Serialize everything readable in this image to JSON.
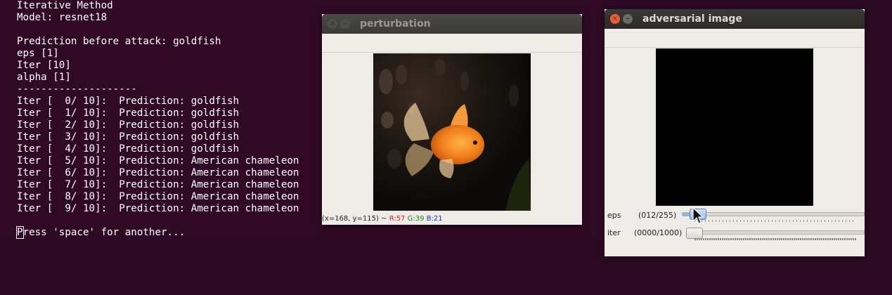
{
  "terminal": {
    "lines": [
      "Iterative Method",
      "Model: resnet18",
      "",
      "Prediction before attack: goldfish",
      "eps [1]",
      "Iter [10]",
      "alpha [1]",
      "--------------------",
      "Iter [  0/ 10]:  Prediction: goldfish",
      "Iter [  1/ 10]:  Prediction: goldfish",
      "Iter [  2/ 10]:  Prediction: goldfish",
      "Iter [  3/ 10]:  Prediction: goldfish",
      "Iter [  4/ 10]:  Prediction: goldfish",
      "Iter [  5/ 10]:  Prediction: American chameleon",
      "Iter [  6/ 10]:  Prediction: American chameleon",
      "Iter [  7/ 10]:  Prediction: American chameleon",
      "Iter [  8/ 10]:  Prediction: American chameleon",
      "Iter [  9/ 10]:  Prediction: American chameleon",
      ""
    ],
    "prompt_cursor_char": "P",
    "prompt_rest": "ress 'space' for another..."
  },
  "perturbation_window": {
    "title": "perturbation",
    "close_glyph": "×",
    "minimize_glyph": "–",
    "status": {
      "coords": "(x=168, y=115) ~",
      "r": "R:57",
      "g": "G:39",
      "b": "B:21"
    }
  },
  "adversarial_window": {
    "title": "adversarial image",
    "close_glyph": "×",
    "minimize_glyph": "–",
    "eps": {
      "label": "eps",
      "value_text": "(012/255)",
      "value": 12,
      "max": 255
    },
    "iter": {
      "label": "iter",
      "value_text": "(0000/1000)",
      "value": 0,
      "max": 1000
    }
  },
  "colors": {
    "terminal_bg": "#300a24",
    "window_bg": "#efebe7",
    "close_active": "#e95f3e"
  },
  "icons": [
    "close-icon",
    "minimize-icon",
    "mouse-pointer-icon"
  ]
}
